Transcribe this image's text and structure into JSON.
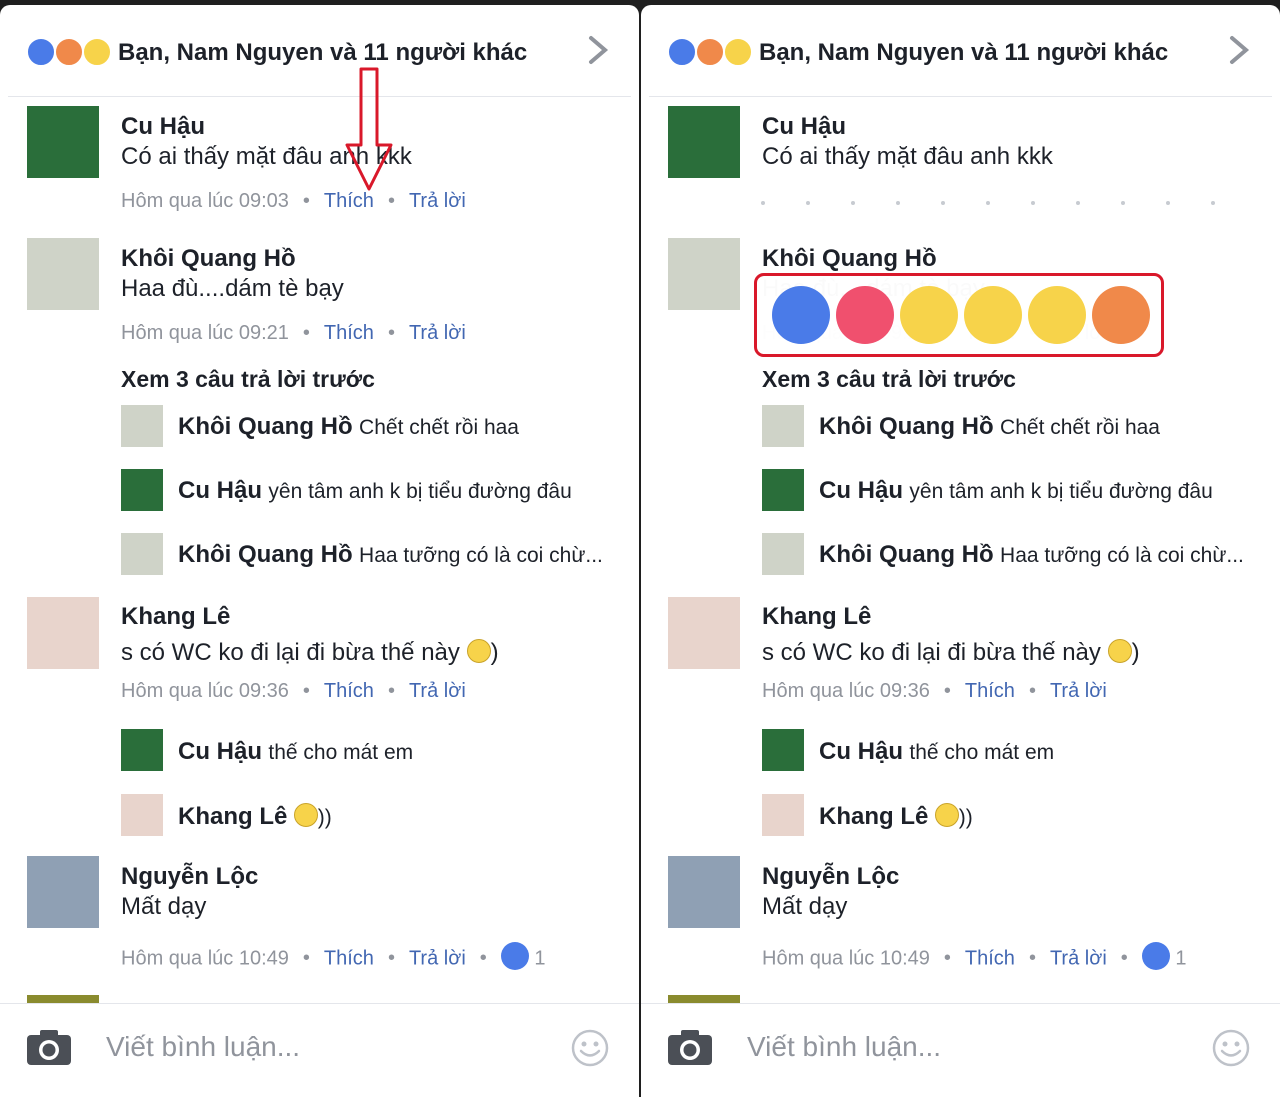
{
  "header": {
    "title": "Bạn, Nam Nguyen và 11 người khác",
    "reactions": [
      "like",
      "angry",
      "haha"
    ]
  },
  "comments": [
    {
      "name": "Cu Hậu",
      "text": "Có ai thấy mặt đâu anh kkk",
      "time": "Hôm qua lúc 09:03",
      "like": "Thích",
      "reply": "Trả lời"
    },
    {
      "name": "Khôi Quang Hồ",
      "text": "Haa đù....dám tè bạy",
      "time": "Hôm qua lúc 09:21",
      "like": "Thích",
      "reply": "Trả lời"
    },
    {
      "name": "Khang Lê",
      "text": "s có WC ko đi lại đi bừa thế này",
      "text_suffix": ")",
      "time": "Hôm qua lúc 09:36",
      "like": "Thích",
      "reply": "Trả lời"
    },
    {
      "name": "Nguyễn Lộc",
      "text": "Mất dạy",
      "time": "Hôm qua lúc 10:49",
      "like": "Thích",
      "reply": "Trả lời",
      "like_count": "1"
    }
  ],
  "more_replies": "Xem 3 câu trả lời trước",
  "replies_block1": [
    {
      "name": "Khôi Quang Hồ",
      "text": "Chết chết rồi haa"
    },
    {
      "name": "Cu Hậu",
      "text": "yên tâm anh k bị tiểu đường đâu"
    },
    {
      "name": "Khôi Quang Hồ",
      "text": "Haa tưỡng có là coi chừ..."
    }
  ],
  "replies_block2": [
    {
      "name": "Cu Hậu",
      "text": "thế cho mát em"
    },
    {
      "name": "Khang Lê",
      "text": "))"
    }
  ],
  "footer": {
    "placeholder": "Viết bình luận..."
  },
  "reaction_picker": [
    "like",
    "love",
    "haha",
    "wow",
    "sad",
    "angry"
  ],
  "colors": {
    "link": "#4267b2",
    "like_blue": "#4a7be8",
    "highlight_red": "#d9182a"
  }
}
